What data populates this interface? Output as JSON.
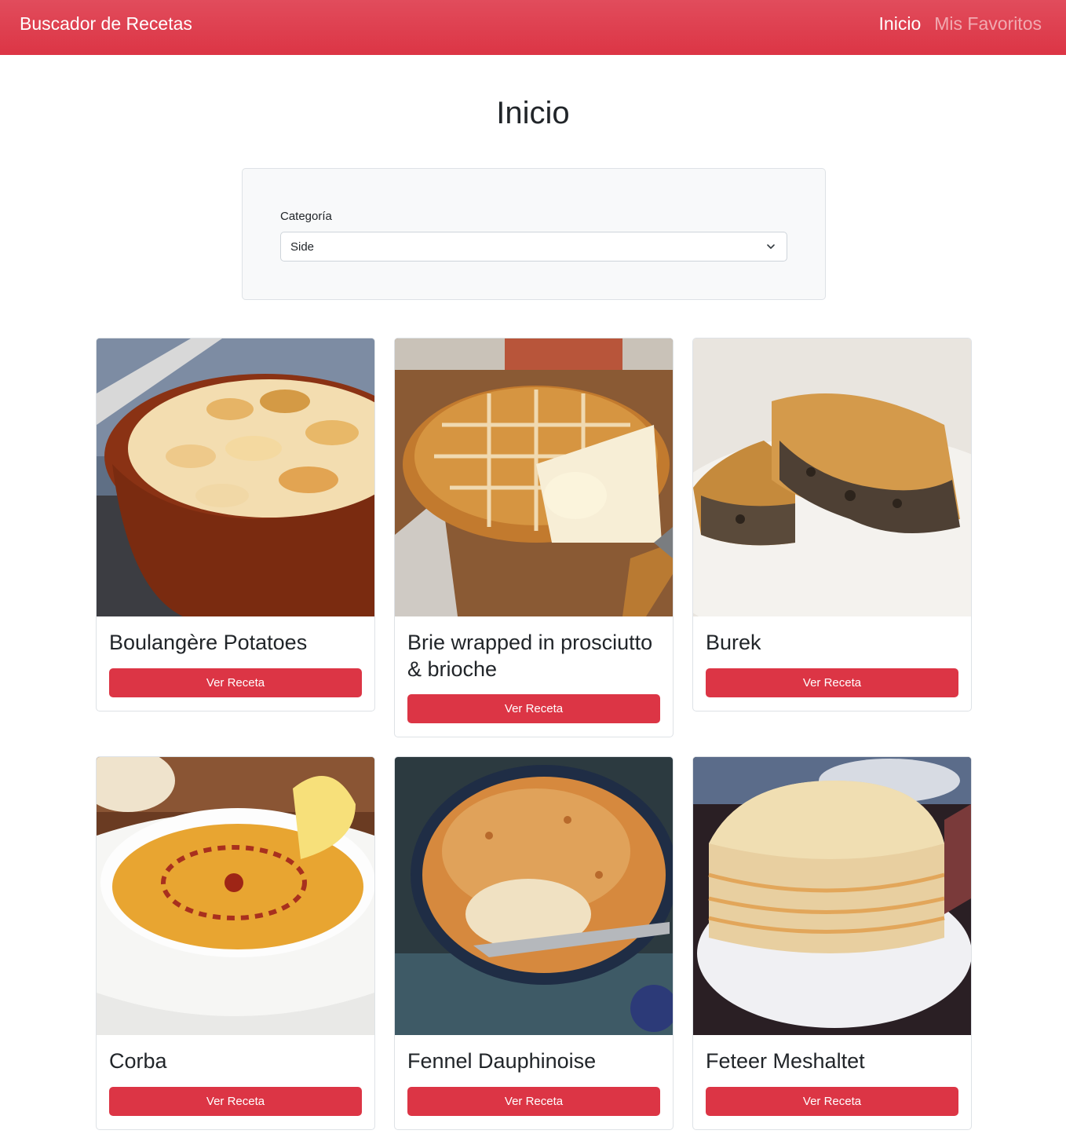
{
  "navbar": {
    "brand": "Buscador de Recetas",
    "links": [
      {
        "label": "Inicio",
        "active": true
      },
      {
        "label": "Mis Favoritos",
        "active": false
      }
    ]
  },
  "page": {
    "title": "Inicio"
  },
  "filter": {
    "label": "Categoría",
    "selected": "Side"
  },
  "recipes": [
    {
      "name": "Boulangère Potatoes",
      "button": "Ver Receta"
    },
    {
      "name": "Brie wrapped in prosciutto & brioche",
      "button": "Ver Receta"
    },
    {
      "name": "Burek",
      "button": "Ver Receta"
    },
    {
      "name": "Corba",
      "button": "Ver Receta"
    },
    {
      "name": "Fennel Dauphinoise",
      "button": "Ver Receta"
    },
    {
      "name": "Feteer Meshaltet",
      "button": "Ver Receta"
    }
  ],
  "colors": {
    "accent": "#dc3545",
    "panel": "#f8f9fa",
    "border": "#dee2e6"
  }
}
